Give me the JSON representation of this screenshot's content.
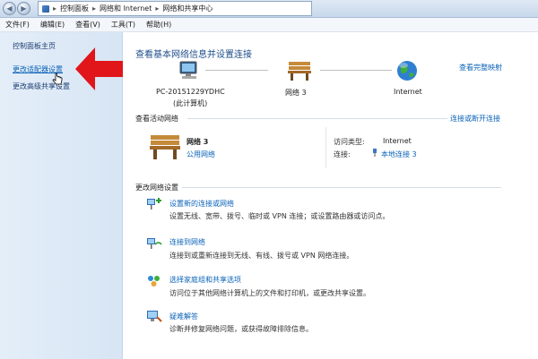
{
  "breadcrumb": [
    "控制面板",
    "网络和 Internet",
    "网络和共享中心"
  ],
  "menu": [
    "文件(F)",
    "编辑(E)",
    "查看(V)",
    "工具(T)",
    "帮助(H)"
  ],
  "sidebar": {
    "items": [
      {
        "label": "控制面板主页"
      },
      {
        "label": "更改适配器设置"
      },
      {
        "label": "更改高级共享设置"
      }
    ]
  },
  "header": {
    "title": "查看基本网络信息并设置连接",
    "full_map_link": "查看完整映射"
  },
  "network_map": {
    "computer_name": "PC-20151229YDHC",
    "computer_note": "(此计算机)",
    "network_name": "网络  3",
    "internet_label": "Internet"
  },
  "active_networks": {
    "title": "查看活动网络",
    "connect_link": "连接或断开连接",
    "network_name": "网络  3",
    "network_type": "公用网络",
    "access_type_label": "访问类型:",
    "access_type_value": "Internet",
    "connection_label": "连接:",
    "connection_value": "本地连接 3"
  },
  "change_settings": {
    "title": "更改网络设置",
    "items": [
      {
        "title": "设置新的连接或网络",
        "desc": "设置无线、宽带、拨号、临时或 VPN 连接；或设置路由器或访问点。",
        "icon": "new-connection-icon"
      },
      {
        "title": "连接到网络",
        "desc": "连接到或重新连接到无线、有线、拨号或 VPN 网络连接。",
        "icon": "connect-network-icon"
      },
      {
        "title": "选择家庭组和共享选项",
        "desc": "访问位于其他网络计算机上的文件和打印机，或更改共享设置。",
        "icon": "homegroup-icon"
      },
      {
        "title": "疑难解答",
        "desc": "诊断并修复网络问题，或获得故障排除信息。",
        "icon": "troubleshoot-icon"
      }
    ]
  },
  "colors": {
    "link": "#0b63b8",
    "arrow": "#e0161b",
    "left_panel": "#dce8f5"
  }
}
